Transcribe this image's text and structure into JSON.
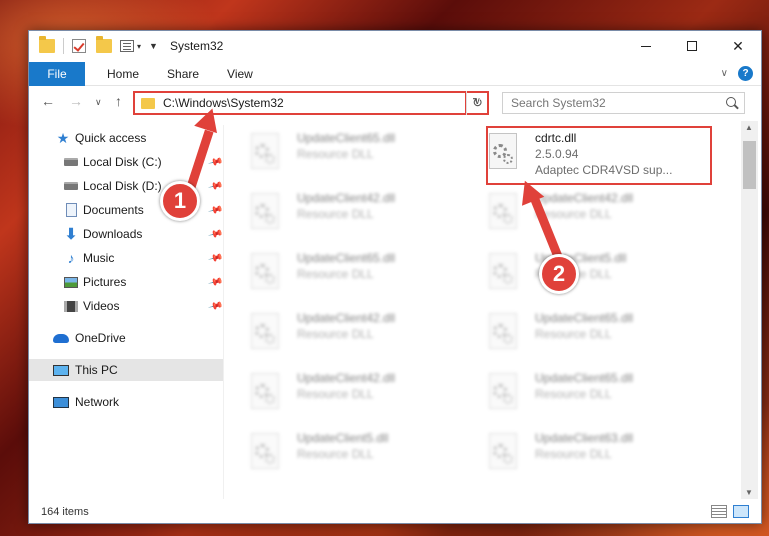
{
  "window": {
    "title": "System32"
  },
  "ribbon": {
    "tabs": [
      "File",
      "Home",
      "Share",
      "View"
    ],
    "help": "?"
  },
  "address": {
    "path": "C:\\Windows\\System32"
  },
  "search": {
    "placeholder": "Search System32"
  },
  "sidebar": {
    "items": [
      {
        "label": "Quick access",
        "icon": "star-icon"
      },
      {
        "label": "Local Disk (C:)",
        "icon": "disk-icon"
      },
      {
        "label": "Local Disk (D:)",
        "icon": "disk-icon"
      },
      {
        "label": "Documents",
        "icon": "documents-icon"
      },
      {
        "label": "Downloads",
        "icon": "downloads-icon"
      },
      {
        "label": "Music",
        "icon": "music-icon"
      },
      {
        "label": "Pictures",
        "icon": "pictures-icon"
      },
      {
        "label": "Videos",
        "icon": "videos-icon"
      },
      {
        "label": "OneDrive",
        "icon": "onedrive-icon"
      },
      {
        "label": "This PC",
        "icon": "this-pc-icon"
      },
      {
        "label": "Network",
        "icon": "network-icon"
      }
    ]
  },
  "files": {
    "left": [
      {
        "name": "UpdateClient65.dll",
        "type": "Resource DLL"
      },
      {
        "name": "UpdateClient42.dll",
        "type": "Resource DLL"
      },
      {
        "name": "UpdateClient65.dll",
        "type": "Resource DLL"
      },
      {
        "name": "UpdateClient42.dll",
        "type": "Resource DLL"
      },
      {
        "name": "UpdateClient42.dll",
        "type": "Resource DLL"
      },
      {
        "name": "UpdateClient5.dll",
        "type": "Resource DLL"
      }
    ],
    "highlighted": {
      "name": "cdrtc.dll",
      "version": "2.5.0.94",
      "description": "Adaptec CDR4VSD sup..."
    },
    "right": [
      {
        "name": "UpdateClient42.dll",
        "type": "Resource DLL"
      },
      {
        "name": "UpdateClient5.dll",
        "type": "Resource DLL"
      },
      {
        "name": "UpdateClient65.dll",
        "type": "Resource DLL"
      },
      {
        "name": "UpdateClient65.dll",
        "type": "Resource DLL"
      },
      {
        "name": "UpdateClient63.dll",
        "type": "Resource DLL"
      }
    ]
  },
  "status": {
    "count": "164 items"
  },
  "callouts": {
    "one": "1",
    "two": "2"
  },
  "colors": {
    "accent": "#1979ca",
    "callout": "#e0413a",
    "selection": "#cce8ff"
  }
}
